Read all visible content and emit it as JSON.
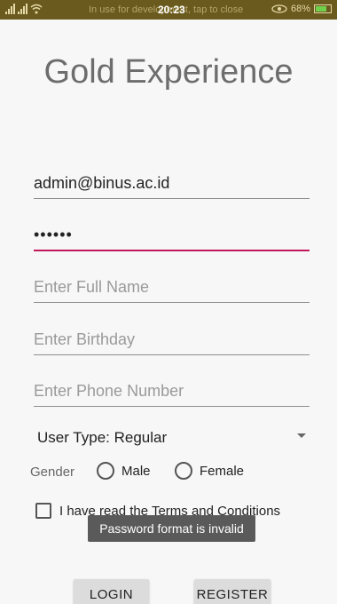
{
  "status_bar": {
    "message": "In use for development, tap to close",
    "time": "20:23",
    "battery": "68%"
  },
  "app": {
    "title": "Gold Experience"
  },
  "form": {
    "email_value": "admin@binus.ac.id",
    "password_value": "••••••",
    "full_name_placeholder": "Enter Full Name",
    "birthday_placeholder": "Enter Birthday",
    "phone_placeholder": "Enter Phone Number",
    "user_type_selected": "User Type: Regular",
    "gender_label": "Gender",
    "gender_options": [
      "Male",
      "Female"
    ],
    "terms_label": "I have read the Terms and Conditions"
  },
  "toast": {
    "message": "Password format is invalid"
  },
  "buttons": {
    "login": "LOGIN",
    "register": "REGISTER"
  },
  "colors": {
    "accent": "#c2185b",
    "status_bar": "#6a5a1e",
    "title": "#6d6d6d"
  }
}
